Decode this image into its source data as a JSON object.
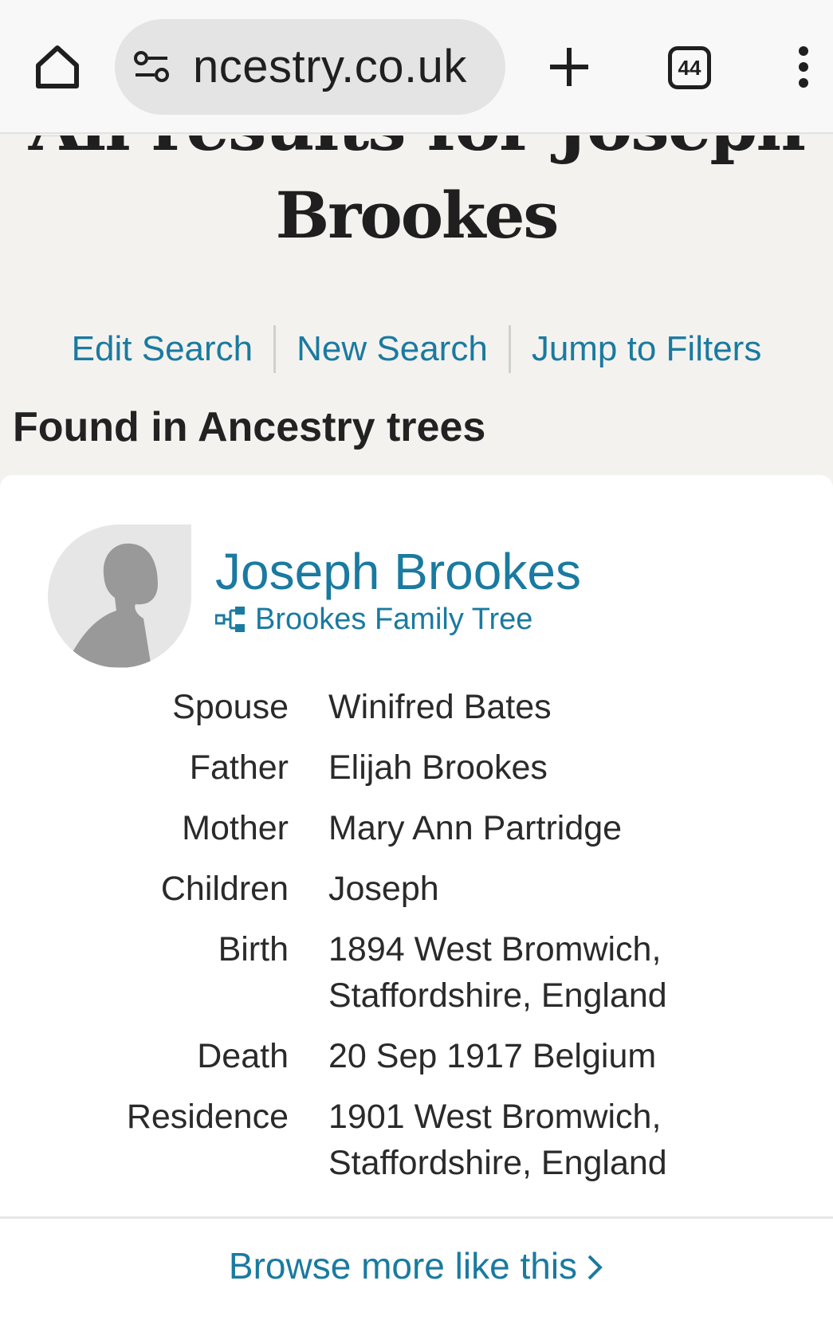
{
  "browser": {
    "url": "ncestry.co.uk",
    "tab_count": "44"
  },
  "page": {
    "heading_partial": "All results for Joseph",
    "heading": "Brookes",
    "links": {
      "edit_search": "Edit Search",
      "new_search": "New Search",
      "jump_to_filters": "Jump to Filters"
    },
    "section_title": "Found in Ancestry trees"
  },
  "result": {
    "name": "Joseph Brookes",
    "tree_name": "Brookes Family Tree",
    "facts": [
      {
        "label": "Spouse",
        "value": "Winifred Bates"
      },
      {
        "label": "Father",
        "value": "Elijah Brookes"
      },
      {
        "label": "Mother",
        "value": "Mary Ann Partridge"
      },
      {
        "label": "Children",
        "value": "Joseph"
      },
      {
        "label": "Birth",
        "value": "1894 West Bromwich, Staffordshire, England"
      },
      {
        "label": "Death",
        "value": "20 Sep 1917 Belgium"
      },
      {
        "label": "Residence",
        "value": "1901 West Bromwich, Staffordshire, England"
      }
    ],
    "browse_more": "Browse more like this"
  },
  "colors": {
    "link": "#1a7aa0",
    "page_bg": "#f4f2ef",
    "card_bg": "#ffffff"
  }
}
